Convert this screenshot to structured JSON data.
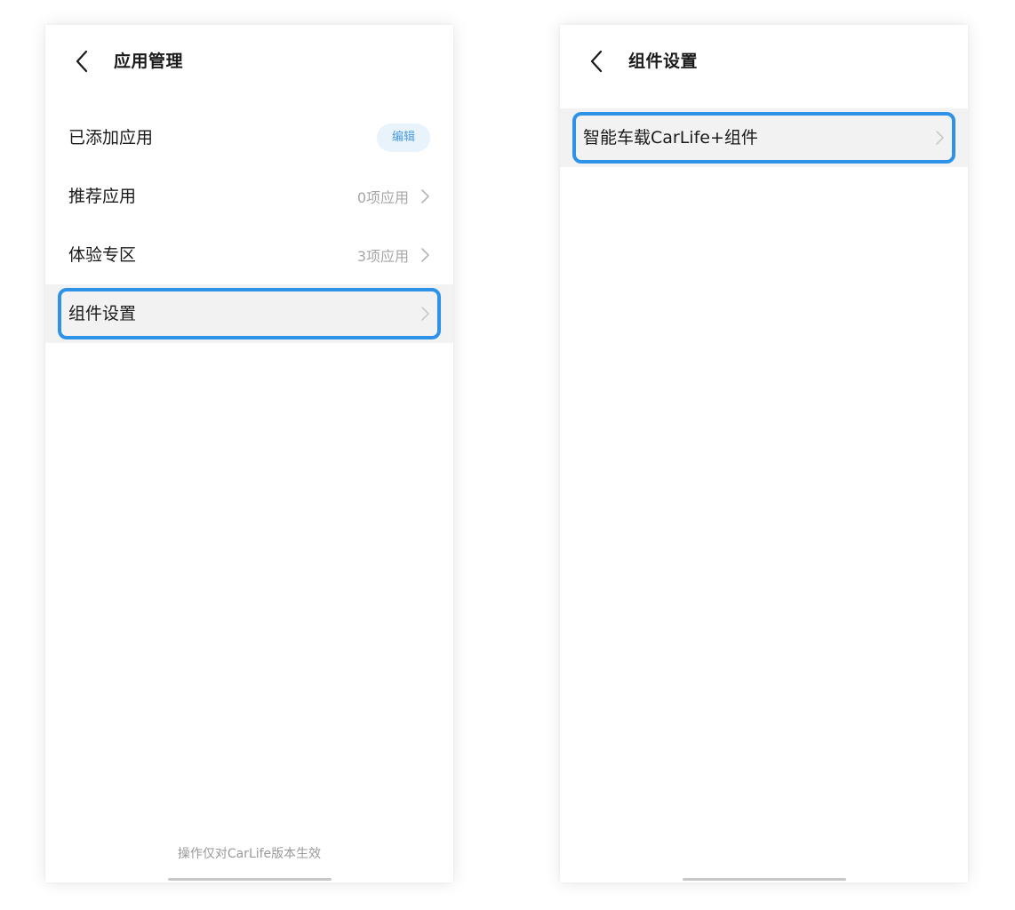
{
  "left_screen": {
    "header": {
      "title": "应用管理",
      "back_icon": "chevron-left-icon"
    },
    "rows": [
      {
        "label": "已添加应用",
        "action_label": "编辑"
      },
      {
        "label": "推荐应用",
        "value": "0项应用"
      },
      {
        "label": "体验专区",
        "value": "3项应用"
      },
      {
        "label": "组件设置",
        "highlighted": true
      }
    ],
    "footer_note": "操作仅对CarLife版本生效"
  },
  "right_screen": {
    "header": {
      "title": "组件设置",
      "back_icon": "chevron-left-icon"
    },
    "rows": [
      {
        "label": "智能车载CarLife+组件",
        "highlighted": true
      }
    ]
  },
  "colors": {
    "accent": "#2e93e8",
    "edit_pill_bg": "#e8f3fc",
    "edit_pill_text": "#4a9ae0",
    "highlight_row": "#f2f2f2",
    "secondary_text": "#a6a6a6"
  }
}
